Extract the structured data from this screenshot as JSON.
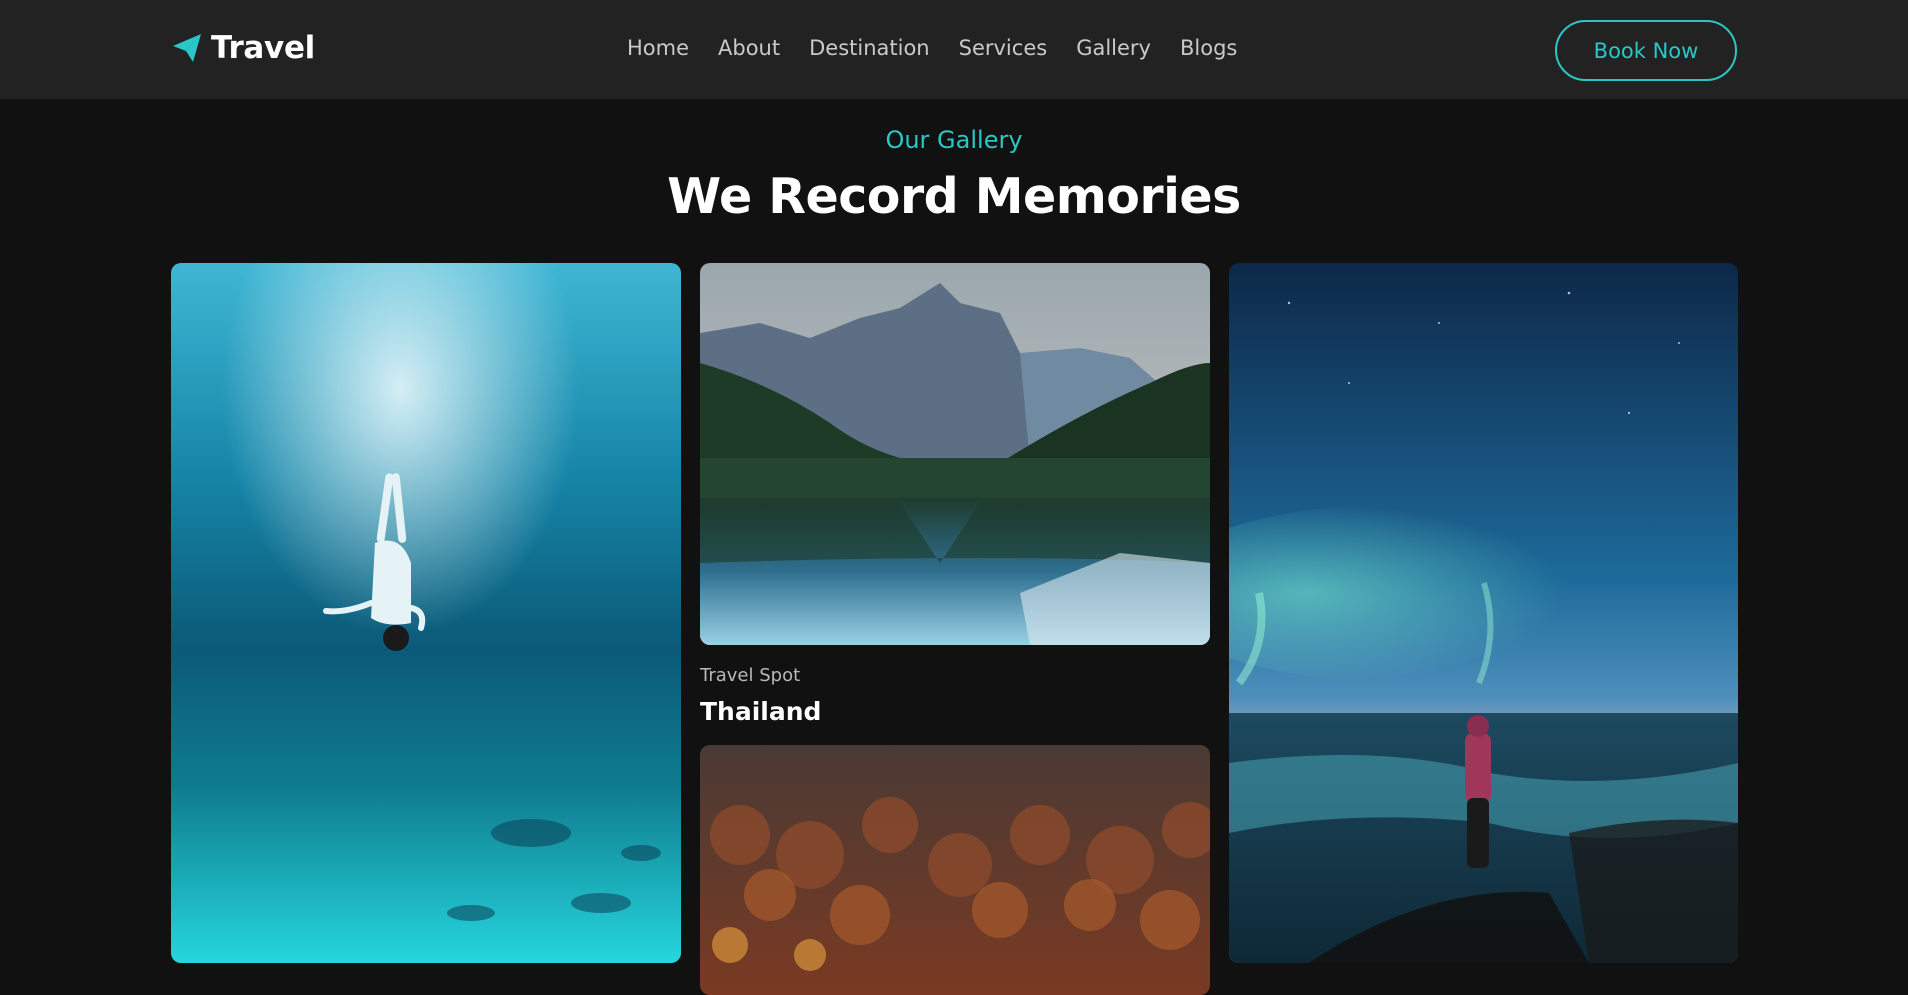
{
  "header": {
    "logo_text": "Travel",
    "nav": [
      "Home",
      "About",
      "Destination",
      "Services",
      "Gallery",
      "Blogs"
    ],
    "cta_label": "Book Now"
  },
  "section": {
    "eyebrow": "Our Gallery",
    "title": "We Record Memories"
  },
  "gallery": {
    "items": [
      {
        "image": "underwater-diver-photo"
      },
      {
        "image": "mountain-lake-photo",
        "label": "Travel Spot",
        "name": "Thailand"
      },
      {
        "image": "autumn-forest-photo"
      },
      {
        "image": "aurora-night-photo"
      }
    ]
  },
  "colors": {
    "accent": "#2bc6c6",
    "navbar_bg": "#222222",
    "page_bg": "#111111"
  }
}
